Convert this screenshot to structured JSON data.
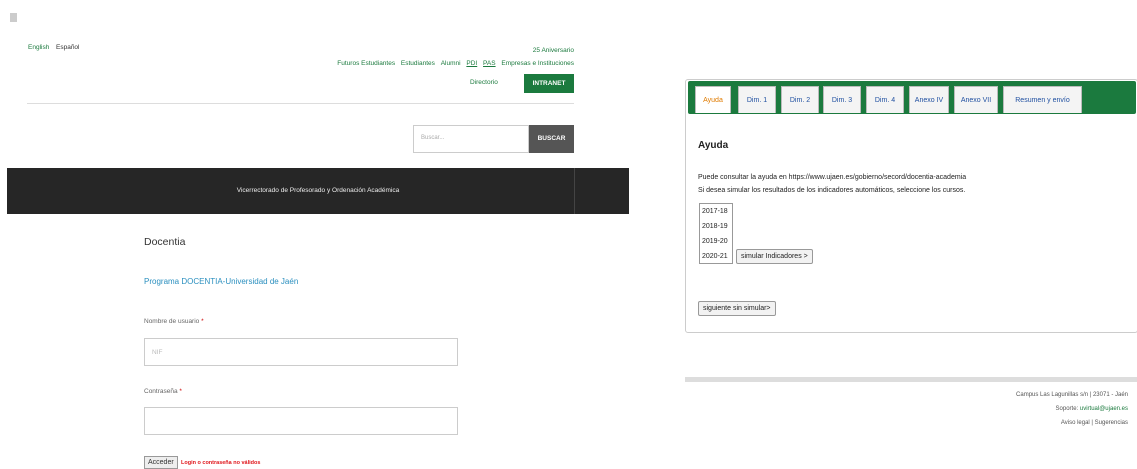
{
  "left": {
    "languages": [
      "English",
      "Español"
    ],
    "top_right": {
      "aniversario": "25 Aniversario",
      "nav_links": [
        "Futuros Estudiantes",
        "Estudiantes",
        "Alumni",
        "PDI",
        "PAS",
        "Empresas e Instituciones"
      ],
      "directorio": "Directorio",
      "intranet": "INTRANET"
    },
    "search": {
      "placeholder": "Buscar...",
      "button": "BUSCAR"
    },
    "banner": "Vicerrectorado de Profesorado y Ordenación Académica",
    "docentia": "Docentia",
    "programa": "Programa DOCENTIA-Universidad de Jaén",
    "form": {
      "user_label": "Nombre de usuario",
      "user_placeholder": "NIF",
      "password_label": "Contraseña",
      "required_mark": "*",
      "submit": "Acceder",
      "error": "Login o contraseña no válidos"
    }
  },
  "right": {
    "tabs": [
      "Ayuda",
      "Dim. 1",
      "Dim. 2",
      "Dim. 3",
      "Dim. 4",
      "Anexo IV",
      "Anexo VII",
      "Resumen y envío"
    ],
    "active_tab": "Ayuda",
    "heading": "Ayuda",
    "line1": "Puede consultar la ayuda en https://www.ujaen.es/gobierno/secord/docentia-academia",
    "line2": "Si desea simular los resultados de los indicadores automáticos, seleccione los cursos.",
    "courses": [
      "2017-18",
      "2018-19",
      "2019-20",
      "2020-21"
    ],
    "simular_button": "simular Indicadores >",
    "siguiente_button": "siguiente sin simular>",
    "footer": {
      "address": "Campus Las Lagunillas s/n | 23071 - Jaén",
      "soporte_label": "Soporte:",
      "soporte_email": "uvirtual@ujaen.es",
      "aviso": "Aviso legal | Sugerencias"
    }
  },
  "colors": {
    "brand_green": "#1b7a3e",
    "banner_dark": "#262626",
    "link_blue": "#2a8fbf",
    "error_red": "#e0161b",
    "tab_active": "#e07b00"
  }
}
